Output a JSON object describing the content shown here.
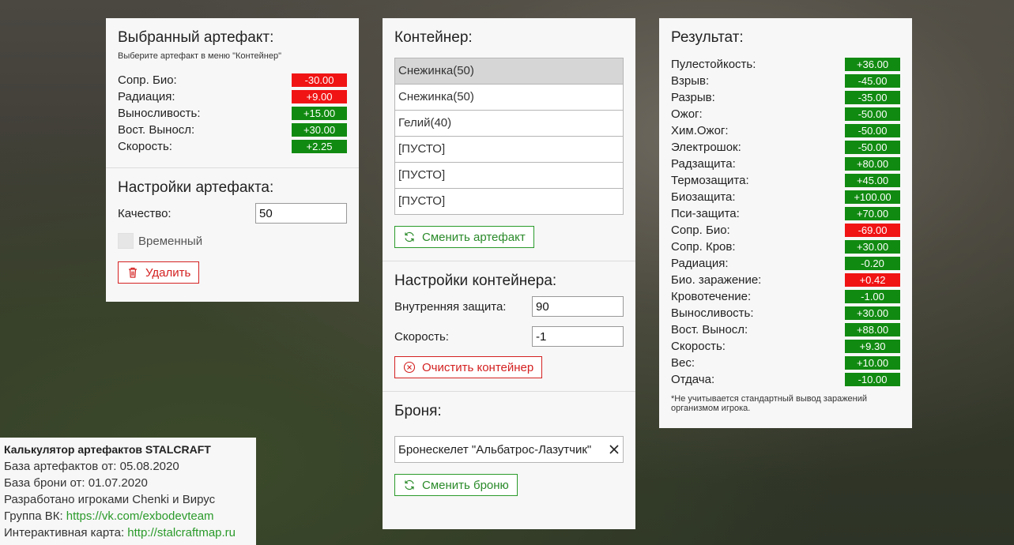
{
  "selected": {
    "title": "Выбранный артефакт:",
    "hint": "Выберите артефакт в меню \"Контейнер\"",
    "stats": [
      {
        "label": "Сопр. Био:",
        "value": "-30.00",
        "color": "neg"
      },
      {
        "label": "Радиация:",
        "value": "+9.00",
        "color": "neg"
      },
      {
        "label": "Выносливость:",
        "value": "+15.00",
        "color": "pos"
      },
      {
        "label": "Вост. Выносл:",
        "value": "+30.00",
        "color": "pos"
      },
      {
        "label": "Скорость:",
        "value": "+2.25",
        "color": "pos"
      }
    ]
  },
  "artifact_settings": {
    "title": "Настройки артефакта:",
    "quality_label": "Качество:",
    "quality_value": "50",
    "temporary_label": "Временный",
    "delete_label": "Удалить"
  },
  "container": {
    "title": "Контейнер:",
    "slots": [
      "Снежинка(50)",
      "Снежинка(50)",
      "Гелий(40)",
      "[ПУСТО]",
      "[ПУСТО]",
      "[ПУСТО]"
    ],
    "change_label": "Сменить артефакт"
  },
  "container_settings": {
    "title": "Настройки контейнера:",
    "protection_label": "Внутренняя защита:",
    "protection_value": "90",
    "speed_label": "Скорость:",
    "speed_value": "-1",
    "clear_label": "Очистить контейнер"
  },
  "armor": {
    "title": "Броня:",
    "value": "Бронескелет \"Альбатрос-Лазутчик\"",
    "change_label": "Сменить броню"
  },
  "result": {
    "title": "Результат:",
    "stats": [
      {
        "label": "Пулестойкость:",
        "value": "+36.00",
        "color": "pos"
      },
      {
        "label": "Взрыв:",
        "value": "-45.00",
        "color": "pos"
      },
      {
        "label": "Разрыв:",
        "value": "-35.00",
        "color": "pos"
      },
      {
        "label": "Ожог:",
        "value": "-50.00",
        "color": "pos"
      },
      {
        "label": "Хим.Ожог:",
        "value": "-50.00",
        "color": "pos"
      },
      {
        "label": "Электрошок:",
        "value": "-50.00",
        "color": "pos"
      },
      {
        "label": "Радзащита:",
        "value": "+80.00",
        "color": "pos"
      },
      {
        "label": "Термозащита:",
        "value": "+45.00",
        "color": "pos"
      },
      {
        "label": "Биозащита:",
        "value": "+100.00",
        "color": "pos"
      },
      {
        "label": "Пси-защита:",
        "value": "+70.00",
        "color": "pos"
      },
      {
        "label": "Сопр. Био:",
        "value": "-69.00",
        "color": "neg"
      },
      {
        "label": "Сопр. Кров:",
        "value": "+30.00",
        "color": "pos"
      },
      {
        "label": "Радиация:",
        "value": "-0.20",
        "color": "pos"
      },
      {
        "label": "Био. заражение:",
        "value": "+0.42",
        "color": "neg"
      },
      {
        "label": "Кровотечение:",
        "value": "-1.00",
        "color": "pos"
      },
      {
        "label": "Выносливость:",
        "value": "+30.00",
        "color": "pos"
      },
      {
        "label": "Вост. Выносл:",
        "value": "+88.00",
        "color": "pos"
      },
      {
        "label": "Скорость:",
        "value": "+9.30",
        "color": "pos"
      },
      {
        "label": "Вес:",
        "value": "+10.00",
        "color": "pos"
      },
      {
        "label": "Отдача:",
        "value": "-10.00",
        "color": "pos"
      }
    ],
    "footnote": "*Не учитывается стандартный вывод заражений организмом игрока."
  },
  "info": {
    "title": "Калькулятор артефактов STALCRAFT",
    "artifacts_db": "База артефактов от: 05.08.2020",
    "armor_db": "База брони от: 01.07.2020",
    "developed": "Разработано игроками Chenki и Вирус",
    "vk_label": "Группа ВК: ",
    "vk_link": "https://vk.com/exbodevteam",
    "map_label": "Интерактивная карта: ",
    "map_link": "http://stalcraftmap.ru"
  },
  "colors": {
    "positive": "#118a11",
    "negative": "#f01414",
    "accent": "#2a9a2a",
    "danger": "#d42020"
  }
}
